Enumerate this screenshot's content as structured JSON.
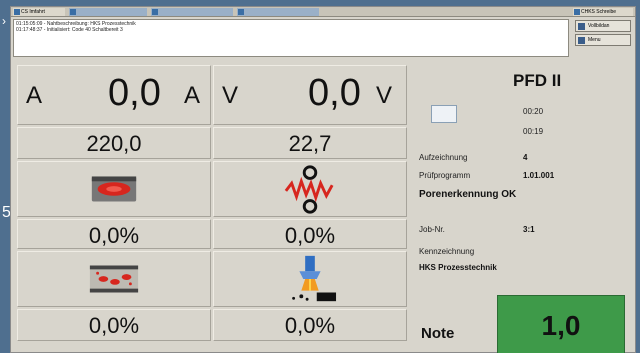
{
  "taskbar": {
    "items": [
      "CS Imfahrt",
      "",
      "",
      "",
      "CHKS Schreibe"
    ]
  },
  "messages": [
    "01:15:05:09 - Nahtbeschreibung: HKS Prozesstechnik",
    "01:17:48:37 - Initialisiert: Code 40 Schaltbereit 3"
  ],
  "side_buttons": [
    "Vollbildan",
    "Menu"
  ],
  "left_panel": {
    "current": {
      "letter": "A",
      "value": "0,0",
      "unit": "A"
    },
    "voltage": {
      "letter": "V",
      "value": "0,0",
      "unit": "V"
    },
    "set_current": "220,0",
    "set_voltage": "22,7",
    "pct_1": "0,0%",
    "pct_2": "0,0%",
    "pct_3": "0,0%",
    "pct_4": "0,0%"
  },
  "right_panel": {
    "title": "PFD II",
    "time_1": "00:20",
    "time_2": "00:19",
    "aufzeichnung_label": "Aufzeichnung",
    "aufzeichnung_value": "4",
    "pruefprogramm_label": "Prüfprogramm",
    "pruefprogramm_value": "1.01.001",
    "status": "Porenerkennung OK",
    "job_label": "Job-Nr.",
    "job_value": "3:1",
    "kennzeichnung_label": "Kennzeichnung",
    "kennzeichnung_value": "HKS Prozesstechnik",
    "note_label": "Note",
    "note_value": "1,0"
  },
  "colors": {
    "note_bg": "#3e9a49",
    "icon_red": "#d7261e",
    "desktop": "#4f6f8f"
  },
  "icons": [
    "pore-icon",
    "arc-wave-icon",
    "spatter-icon",
    "torch-icon",
    "document-icon"
  ]
}
